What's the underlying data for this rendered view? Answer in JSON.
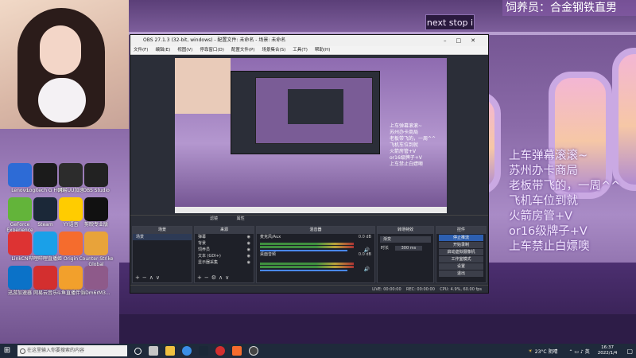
{
  "stream_title": "饲养员：合金钢铁直男",
  "scene_sign": "next stop i",
  "danmaku": [
    "上车弹幕滚滚~",
    "苏州办卡商局",
    "老板带飞的，一周^^",
    "飞机车位到就",
    "火箭房管+V",
    "or16级牌子+V",
    "上车禁止白嫖噢"
  ],
  "desktop_icons": [
    {
      "label": "Lenovo",
      "color": "#2d6bd6"
    },
    {
      "label": "GeForce Experience",
      "color": "#63b43a"
    },
    {
      "label": "LinkCN",
      "color": "#d33"
    },
    {
      "label": "迅游加速器",
      "color": "#0b72c8"
    },
    {
      "label": "Logitech G HUB",
      "color": "#1b1b1b"
    },
    {
      "label": "Steam",
      "color": "#1b2838"
    },
    {
      "label": "哔哩哔哩直播姬",
      "color": "#1aa0e8"
    },
    {
      "label": "网易云音乐",
      "color": "#d32f2f"
    },
    {
      "label": "网易UU加速",
      "color": "#2c2c2c"
    },
    {
      "label": "YY语音",
      "color": "#ffcc00"
    },
    {
      "label": "Origin",
      "color": "#f56c2d"
    },
    {
      "label": "斗鱼直播伴侣",
      "color": "#f2a02c"
    },
    {
      "label": "OBS Studio",
      "color": "#222"
    },
    {
      "label": "剪映专业版",
      "color": "#111"
    },
    {
      "label": "Counter-Strike Global Offensive",
      "color": "#e8a33a"
    },
    {
      "label": "uDm6rM3...",
      "color": "#8e5a8a"
    }
  ],
  "obs": {
    "title": "OBS 27.1.3 (32-bit, windows) - 配置文件: 未命名 - 场景: 未命名",
    "menu": [
      "文件(F)",
      "编辑(E)",
      "视图(V)",
      "停靠窗口(D)",
      "配置文件(P)",
      "场景集合(S)",
      "工具(T)",
      "帮助(H)"
    ],
    "docks": {
      "scenes": {
        "title": "场景",
        "items": [
          "场景"
        ]
      },
      "sources": {
        "title": "来源",
        "items": [
          "弹幕",
          "背景",
          "饲养员",
          "文本 (GDI+)",
          "显示器采集"
        ]
      },
      "mixer": {
        "title": "混音器",
        "tracks": [
          {
            "name": "麦克风/Aux",
            "db": "0.0 dB"
          },
          {
            "name": "桌面音频",
            "db": "0.0 dB"
          }
        ]
      },
      "transitions": {
        "title": "转场特效",
        "type": "渐变",
        "duration_label": "时长",
        "duration": "300 ms"
      },
      "controls": {
        "title": "控件",
        "buttons": [
          "停止推流",
          "开始录制",
          "启动虚拟摄像机",
          "工作室模式",
          "设置",
          "退出"
        ]
      }
    },
    "status": {
      "live": "LIVE: 00:00:00",
      "rec": "REC: 00:00:00",
      "cpu": "CPU: 4.9%, 60.00 fps"
    },
    "filter_tabs": [
      "滤镜",
      "属性"
    ]
  },
  "taskbar": {
    "search_placeholder": "在这里输入你要搜索的内容",
    "weather": "23°C 阴晴",
    "time": "16:37",
    "date": "2022/1/4"
  }
}
